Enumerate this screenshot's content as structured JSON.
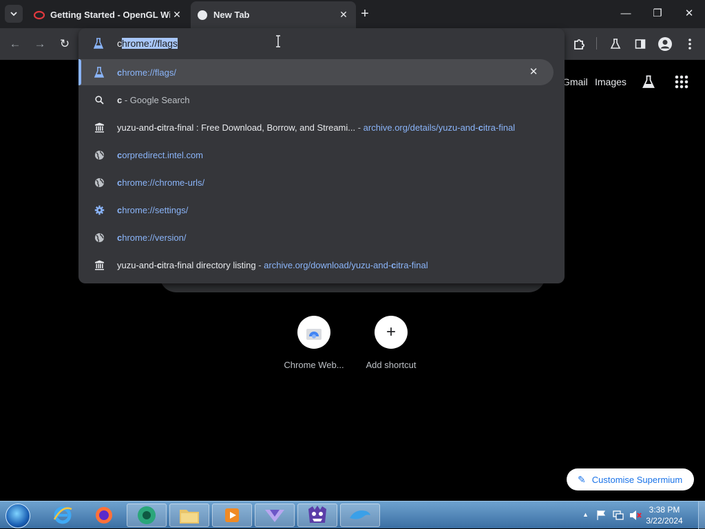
{
  "tabs": [
    {
      "title": "Getting Started - OpenGL Wiki",
      "close": "✕"
    },
    {
      "title": "New Tab",
      "close": "✕"
    }
  ],
  "tab_search_icon": "chevron-down-icon",
  "new_tab_glyph": "+",
  "window_controls": {
    "minimize": "—",
    "restore": "❐",
    "close": "✕"
  },
  "toolbar": {
    "back": "←",
    "forward": "→",
    "reload": "↻"
  },
  "omnibox": {
    "typed_char": "c",
    "autocomplete_selected": "hrome://flags",
    "suggestions": [
      {
        "icon": "flask-icon",
        "parts": [
          [
            "c",
            "b c-url"
          ],
          [
            "hrome://flags/",
            "c-url"
          ]
        ],
        "remove": "✕"
      },
      {
        "icon": "search-icon",
        "parts": [
          [
            "c",
            "b c-text"
          ],
          [
            " - Google Search",
            "c-dim"
          ]
        ]
      },
      {
        "icon": "archive-icon",
        "parts": [
          [
            "yuzu-and-",
            "c-text"
          ],
          [
            "c",
            "b c-text"
          ],
          [
            "itra-final : Free Download, Borrow, and Streami...",
            "c-text"
          ],
          [
            " - ",
            "c-dim"
          ],
          [
            "archive.org/details/yuzu-and-",
            "c-url"
          ],
          [
            "c",
            "b c-url"
          ],
          [
            "itra-final",
            "c-url"
          ]
        ]
      },
      {
        "icon": "globe-icon",
        "parts": [
          [
            "c",
            "b c-url"
          ],
          [
            "orpredirect.intel.com",
            "c-url"
          ]
        ]
      },
      {
        "icon": "globe-icon",
        "parts": [
          [
            "c",
            "b c-url"
          ],
          [
            "hrome://chrome-urls/",
            "c-url"
          ]
        ]
      },
      {
        "icon": "gear-icon",
        "parts": [
          [
            "c",
            "b c-url"
          ],
          [
            "hrome://settings/",
            "c-url"
          ]
        ]
      },
      {
        "icon": "globe-icon",
        "parts": [
          [
            "c",
            "b c-url"
          ],
          [
            "hrome://version/",
            "c-url"
          ]
        ]
      },
      {
        "icon": "archive-icon",
        "parts": [
          [
            "yuzu-and-",
            "c-text"
          ],
          [
            "c",
            "b c-text"
          ],
          [
            "itra-final directory listing",
            "c-text"
          ],
          [
            " - ",
            "c-dim"
          ],
          [
            "archive.org/download/yuzu-and-",
            "c-url"
          ],
          [
            "c",
            "b c-url"
          ],
          [
            "itra-final",
            "c-url"
          ]
        ]
      }
    ]
  },
  "ntp": {
    "gmail": "Gmail",
    "images": "Images",
    "shortcuts": [
      {
        "label": "Chrome Web...",
        "icon": "chrome-web-store-icon"
      },
      {
        "label": "Add shortcut",
        "icon": "plus-icon",
        "glyph": "+"
      }
    ],
    "customise": "Customise Supermium",
    "customise_glyph": "✎"
  },
  "taskbar": {
    "time": "3:38 PM",
    "date": "3/22/2024",
    "tray_arrow": "▲"
  },
  "colors": {
    "accent": "#8ab4f8",
    "selection": "#a8c7fa",
    "toolbar": "#35363a",
    "tabstrip": "#202124"
  }
}
